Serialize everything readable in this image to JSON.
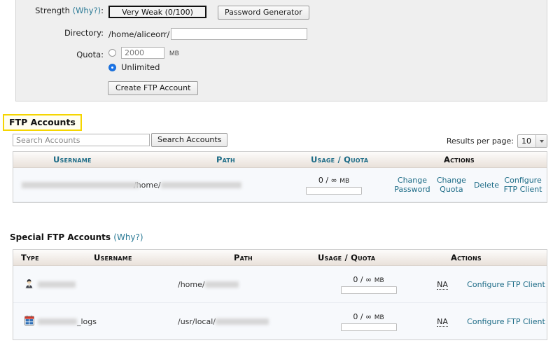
{
  "form": {
    "strength": {
      "label": "Strength",
      "why": "(Why?)",
      "colon": ":",
      "value": "Very Weak (0/100)",
      "generator_button": "Password Generator"
    },
    "directory": {
      "label": "Directory:",
      "prefix": "/home/aliceorr/",
      "value": "",
      "placeholder": ""
    },
    "quota": {
      "label": "Quota:",
      "amount_value": "2000",
      "amount_placeholder": "2000",
      "unit": "MB",
      "unlimited_label": "Unlimited",
      "selected": "unlimited"
    },
    "create_button": "Create FTP Account"
  },
  "ftp_accounts": {
    "title": "FTP Accounts",
    "search": {
      "placeholder": "Search Accounts",
      "value": "",
      "button": "Search Accounts"
    },
    "results_per_page": {
      "label": "Results per page:",
      "value": "10"
    },
    "columns": [
      "Username",
      "Path",
      "Usage / Quota",
      "Actions"
    ],
    "rows": [
      {
        "username": "",
        "path_prefix": "/home/",
        "path_suffix": "",
        "usage": "0 / ∞",
        "usage_unit": "MB",
        "usage_percent": 0,
        "actions": [
          "Change Password",
          "Change Quota",
          "Delete",
          "Configure FTP Client"
        ]
      }
    ]
  },
  "special_ftp_accounts": {
    "title": "Special FTP Accounts",
    "why": "(Why?)",
    "columns": [
      "Type",
      "Username",
      "Path",
      "Usage / Quota",
      "Actions"
    ],
    "rows": [
      {
        "icon": "user-icon",
        "username": "",
        "username_suffix": "",
        "path_prefix": "/home/",
        "path_suffix": "",
        "usage": "0 / ∞",
        "usage_unit": "MB",
        "usage_percent": 0,
        "quota_na": "NA",
        "action": "Configure FTP Client"
      },
      {
        "icon": "log-icon",
        "username": "",
        "username_suffix": "_logs",
        "path_prefix": "/usr/local/",
        "path_suffix": "",
        "usage": "0 / ∞",
        "usage_unit": "MB",
        "usage_percent": 0,
        "quota_na": "NA",
        "action": "Configure FTP Client"
      }
    ]
  },
  "colors": {
    "link": "#1c6b86",
    "highlight_border": "#f5d500",
    "panel_bg": "#efefef",
    "row_bg": "#f7f9fc",
    "header_grad_end": "#e9e1da",
    "radio_on": "#1a73e8"
  }
}
